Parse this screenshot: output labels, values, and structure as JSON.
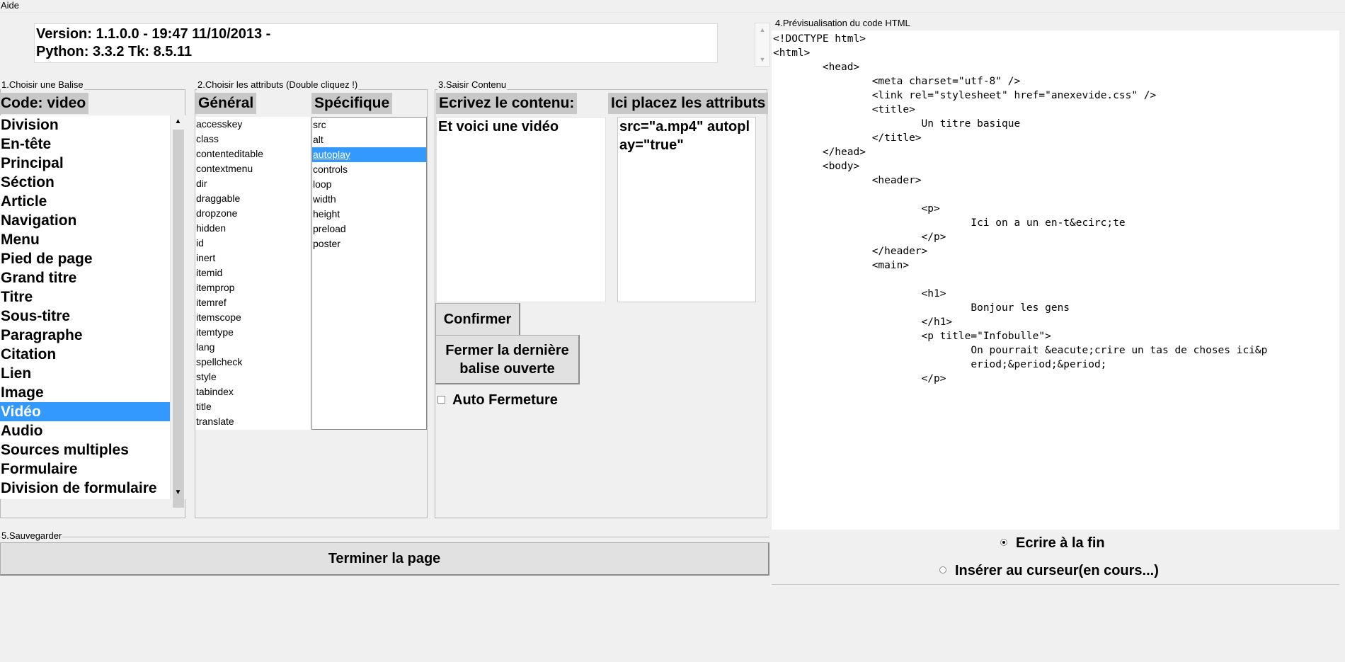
{
  "menu": {
    "help": "Aide"
  },
  "version": {
    "line1": "Version: 1.1.0.0 - 19:47 11/10/2013 -",
    "line2": "Python: 3.3.2 Tk: 8.5.11"
  },
  "section1": {
    "label": "1.Choisir une Balise",
    "code_header": "Code: video",
    "selected_index": 15,
    "tags": [
      "Division",
      "En-tête",
      "Principal",
      "Séction",
      "Article",
      "Navigation",
      "Menu",
      "Pied de page",
      "Grand titre",
      "Titre",
      "Sous-titre",
      "Paragraphe",
      "Citation",
      "Lien",
      "Image",
      "Vidéo",
      "Audio",
      "Sources multiples",
      "Formulaire",
      "Division de formulaire"
    ]
  },
  "section2": {
    "label": "2.Choisir les attributs (Double cliquez !)",
    "general_header": "Général",
    "specific_header": "Spécifique",
    "general": [
      "accesskey",
      "class",
      "contenteditable",
      "contextmenu",
      "dir",
      "draggable",
      "dropzone",
      "hidden",
      "id",
      "inert",
      "itemid",
      "itemprop",
      "itemref",
      "itemscope",
      "itemtype",
      "lang",
      "spellcheck",
      "style",
      "tabindex",
      "title",
      "translate"
    ],
    "specific_selected_index": 2,
    "specific": [
      "src",
      "alt",
      "autoplay",
      "controls",
      "loop",
      "width",
      "height",
      "preload",
      "poster"
    ]
  },
  "section3": {
    "label": "3.Saisir Contenu",
    "content_header": "Ecrivez le contenu:",
    "attr_header": "Ici placez les attributs",
    "content_value": "Et voici une vidéo",
    "attr_value": " src=\"a.mp4\" autoplay=\"true\"",
    "confirm_label": "Confirmer",
    "close_label_1": "Fermer la dernière",
    "close_label_2": "balise ouverte",
    "auto_close_label": "Auto Fermeture"
  },
  "section4": {
    "label": "4.Prévisualisation du code HTML",
    "code": "<!DOCTYPE html>\n<html>\n\t<head>\n\t\t<meta charset=\"utf-8\" />\n\t\t<link rel=\"stylesheet\" href=\"anexevide.css\" />\n\t\t<title>\n\t\t\tUn titre basique\n\t\t</title>\n\t</head>\n\t<body>\n\t\t<header>\n\n\t\t\t<p>\n\t\t\t\tIci on a un en-t&ecirc;te\n\t\t\t</p>\n\t\t</header>\n\t\t<main>\n\n\t\t\t<h1>\n\t\t\t\tBonjour les gens\n\t\t\t</h1>\n\t\t\t<p title=\"Infobulle\">\n\t\t\t\tOn pourrait &eacute;crire un tas de choses ici&p\n\t\t\t\teriod;&period;&period;\n\t\t\t</p>",
    "radio_end": "Ecrire à la fin",
    "radio_cursor": "Insérer au curseur(en cours...)"
  },
  "section5": {
    "label": "5.Sauvegarder",
    "finish_label": "Terminer la page"
  }
}
